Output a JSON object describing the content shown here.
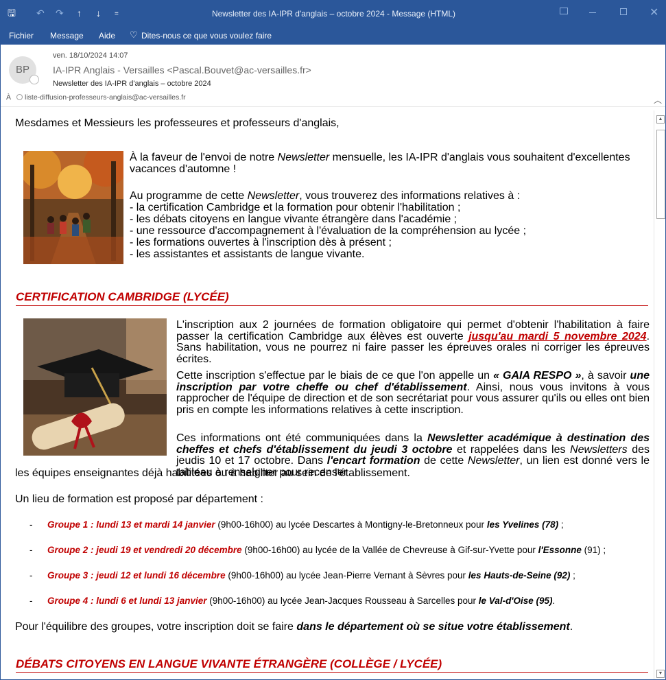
{
  "window": {
    "title": "Newsletter des IA-IPR d'anglais – octobre 2024  -  Message (HTML)",
    "qa_up": "↑",
    "qa_down": "↓",
    "qa_more": "=",
    "qa_save": "🖫",
    "qa_undo": "↶",
    "qa_redo": "↷"
  },
  "menu": {
    "items": [
      "Fichier",
      "Message",
      "Aide"
    ],
    "tellme": "Dites-nous ce que vous voulez faire"
  },
  "header": {
    "date": "ven. 18/10/2024 14:07",
    "avatar": "BP",
    "sender": "IA-IPR Anglais - Versailles <Pascal.Bouvet@ac-versailles.fr>",
    "subject": "Newsletter des IA-IPR d'anglais – octobre 2024",
    "to_label": "À",
    "to_value": "liste-diffusion-professeurs-anglais@ac-versailles.fr"
  },
  "body": {
    "greeting": "Mesdames et Messieurs les professeures et professeurs d'anglais,",
    "intro_a": "À la faveur de l'envoi de notre ",
    "intro_b": "Newsletter",
    "intro_c": " mensuelle, les IA-IPR d'anglais vous souhaitent d'excellentes vacances d'automne !",
    "prog_a": "Au programme de cette ",
    "prog_b": "Newsletter",
    "prog_c": ", vous trouverez des informations relatives à :",
    "list": [
      "- la certification Cambridge et la formation pour obtenir l'habilitation ;",
      "- les débats citoyens en langue vivante étrangère dans l'académie ;",
      "- une ressource d'accompagnement à l'évaluation de la compréhension au lycée ;",
      "- les formations ouvertes à l'inscription dès à présent ;",
      "- les assistantes et assistants de langue vivante."
    ],
    "h_cambridge": "CERTIFICATION CAMBRIDGE (LYCÉE)",
    "c1_a": "L'inscription aux 2 journées de formation obligatoire qui permet d'obtenir l'habilitation à faire passer la certification Cambridge aux élèves est ouverte ",
    "c1_b": "jusqu'au mardi 5 novembre 2024",
    "c1_c": ". Sans habilitation, vous ne pourrez ni faire passer les épreuves orales ni corriger les épreuves écrites.",
    "c2_a": "Cette inscription s'effectue par le biais de ce que l'on appelle un ",
    "c2_b": "« GAIA RESPO »",
    "c2_c": ", à savoir ",
    "c2_d": "une inscription par votre cheffe ou chef d'établissement",
    "c2_e": ". Ainsi, nous vous invitons à vous rapprocher de l'équipe de direction et de son secrétariat pour vous assurer qu'ils ou elles ont bien pris en compte les informations relatives à cette inscription.",
    "c3_a": "Ces informations ont été communiquées dans la ",
    "c3_b": "Newsletter académique à destination des cheffes et chefs d'établissement du jeudi 3 octobre",
    "c3_c": " et rappelées dans les ",
    "c3_d": "Newsletters",
    "c3_e": " des jeudis 10 et 17 octobre. Dans ",
    "c3_f": "l'encart formation",
    "c3_g": " de cette ",
    "c3_h": "Newsletter",
    "c3_i": ", un lien est donné vers le tableau à renseigner pour recenser",
    "c3_j": "les équipes enseignantes déjà habilitées ou à habiliter au sein de l'établissement.",
    "lieu": "Un lieu de formation est proposé par département :",
    "groups": [
      {
        "g": "Groupe 1 : lundi 13 et mardi 14 janvier",
        "m": " (9h00-16h00) au lycée Descartes à Montigny-le-Bretonneux pour ",
        "d": "les Yvelines (78)",
        "e": " ;"
      },
      {
        "g": "Groupe 2 : jeudi 19 et vendredi 20 décembre",
        "m": " (9h00-16h00) au lycée de la Vallée de Chevreuse à Gif-sur-Yvette pour ",
        "d": "l'Essonne",
        "e": " (91) ;"
      },
      {
        "g": "Groupe 3 : jeudi 12 et lundi 16 décembre",
        "m": " (9h00-16h00) au lycée Jean-Pierre Vernant à Sèvres pour ",
        "d": "les Hauts-de-Seine (92)",
        "e": " ;"
      },
      {
        "g": "Groupe 4 : lundi 6 et lundi 13 janvier",
        "m": " (9h00-16h00) au lycée Jean-Jacques Rousseau à Sarcelles pour ",
        "d": "le Val-d'Oise (95)",
        "e": "."
      }
    ],
    "equi_a": "Pour l'équilibre des groupes, votre inscription doit se faire ",
    "equi_b": "dans le département où se situe votre établissement",
    "equi_c": ".",
    "h_debats": "DÉBATS CITOYENS EN LANGUE VIVANTE ÉTRANGÈRE (COLLÈGE / LYCÉE)"
  }
}
